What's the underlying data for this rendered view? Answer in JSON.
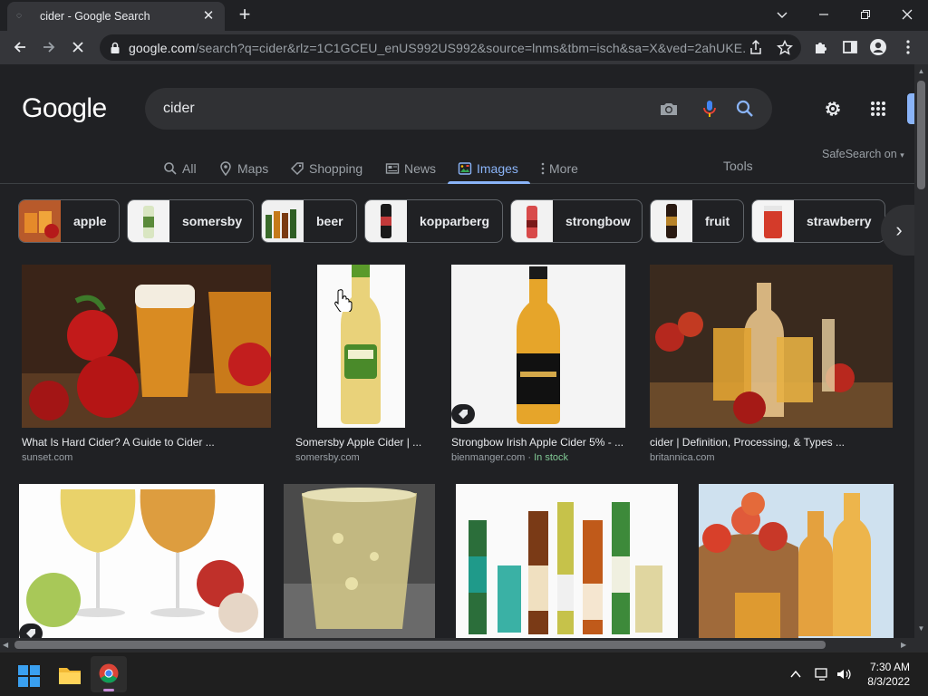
{
  "browser": {
    "tab_title": "cider - Google Search",
    "url_host": "google.com",
    "url_path": "/search?q=cider&rlz=1C1GCEU_enUS992US992&source=lnms&tbm=isch&sa=X&ved=2ahUKE..."
  },
  "search": {
    "logo": "Google",
    "query": "cider"
  },
  "tabs": [
    {
      "label": "All",
      "icon": "search-icon"
    },
    {
      "label": "Maps",
      "icon": "map-pin-icon"
    },
    {
      "label": "Shopping",
      "icon": "tag-icon"
    },
    {
      "label": "News",
      "icon": "news-icon"
    },
    {
      "label": "Images",
      "icon": "images-icon",
      "active": true
    },
    {
      "label": "More",
      "icon": "more-vert-icon"
    }
  ],
  "tools_label": "Tools",
  "safesearch_label": "SafeSearch on",
  "chips": [
    "apple",
    "somersby",
    "beer",
    "kopparberg",
    "strongbow",
    "fruit",
    "strawberry"
  ],
  "results": [
    {
      "caption": "What Is Hard Cider? A Guide to Cider ...",
      "source": "sunset.com"
    },
    {
      "caption": "Somersby Apple Cider | ...",
      "source": "somersby.com"
    },
    {
      "caption": "Strongbow Irish Apple Cider 5% - ...",
      "source": "bienmanger.com",
      "stock": "In stock"
    },
    {
      "caption": "cider | Definition, Processing, & Types ...",
      "source": "britannica.com"
    }
  ],
  "taskbar": {
    "time": "7:30 AM",
    "date": "8/3/2022"
  },
  "colors": {
    "background": "#202124",
    "accent": "#8ab4f8",
    "in_stock": "#81c995"
  }
}
